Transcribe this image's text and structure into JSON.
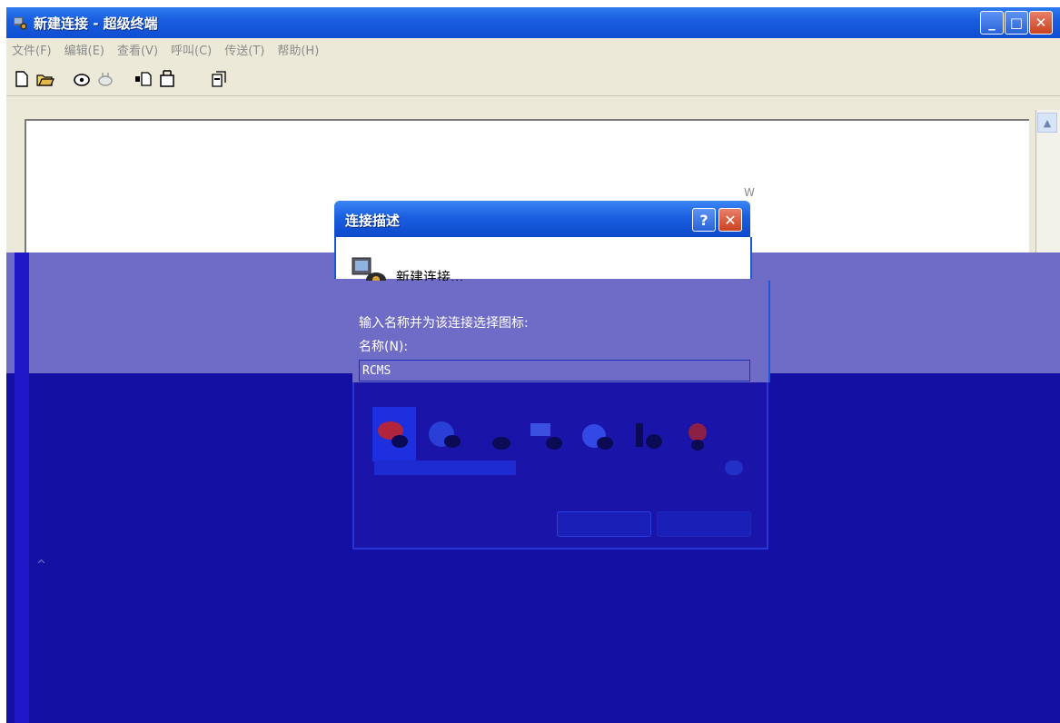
{
  "window": {
    "title": "新建连接 - 超级终端",
    "icon": "hyperterminal-icon",
    "controls": {
      "minimize": "_",
      "maximize": "□",
      "close": "✕"
    }
  },
  "menu": {
    "items": [
      {
        "label": "文件(F)"
      },
      {
        "label": "编辑(E)"
      },
      {
        "label": "查看(V)"
      },
      {
        "label": "呼叫(C)"
      },
      {
        "label": "传送(T)"
      },
      {
        "label": "帮助(H)"
      }
    ]
  },
  "toolbar": {
    "icons": [
      "new-icon",
      "open-icon",
      "call-icon",
      "disconnect-icon",
      "send-icon",
      "receive-icon",
      "properties-icon"
    ]
  },
  "terminal": {
    "stray_text": "W",
    "caret": "^"
  },
  "dialog": {
    "title": "连接描述",
    "help": "?",
    "close": "✕",
    "connection_name": "新建连接...",
    "prompt": "输入名称并为该连接选择图标:",
    "name_label": "名称(N):",
    "name_value": "RCMS",
    "buttons": {
      "ok": "",
      "cancel": ""
    }
  },
  "colors": {
    "xp_blue": "#1b5ee0",
    "menu_bg": "#ece9d8",
    "dither_violet": "#6f6cc7",
    "dither_navy": "#1410a3"
  }
}
